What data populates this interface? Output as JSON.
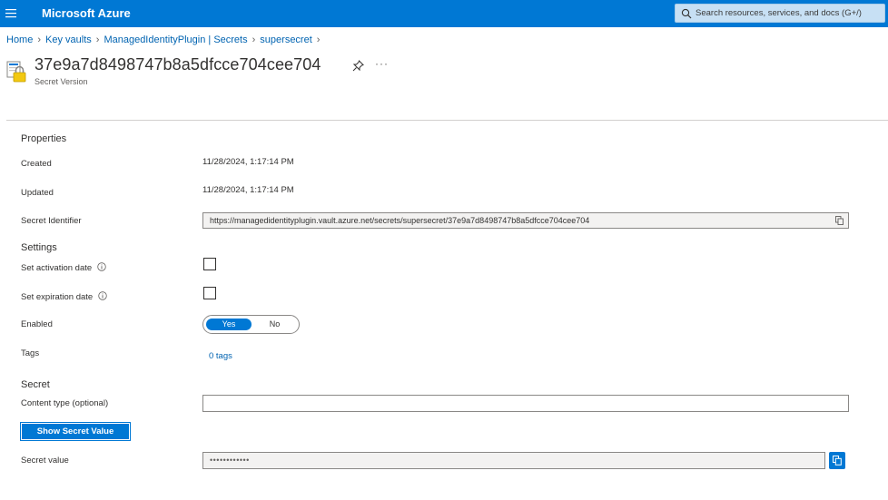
{
  "topbar": {
    "brand": "Microsoft Azure",
    "search_placeholder": "Search resources, services, and docs (G+/)"
  },
  "breadcrumb": {
    "items": [
      "Home",
      "Key vaults",
      "ManagedIdentityPlugin | Secrets",
      "supersecret"
    ]
  },
  "header": {
    "title": "37e9a7d8498747b8a5dfcce704cee704",
    "subtitle": "Secret Version",
    "more": "···"
  },
  "properties": {
    "heading": "Properties",
    "created_label": "Created",
    "created_value": "11/28/2024, 1:17:14 PM",
    "updated_label": "Updated",
    "updated_value": "11/28/2024, 1:17:14 PM",
    "identifier_label": "Secret Identifier",
    "identifier_value": "https://managedidentityplugin.vault.azure.net/secrets/supersecret/37e9a7d8498747b8a5dfcce704cee704"
  },
  "settings": {
    "heading": "Settings",
    "activation_label": "Set activation date",
    "expiration_label": "Set expiration date",
    "enabled_label": "Enabled",
    "enabled_yes": "Yes",
    "enabled_no": "No",
    "tags_label": "Tags",
    "tags_value": "0 tags"
  },
  "secret": {
    "heading": "Secret",
    "content_type_label": "Content type (optional)",
    "content_type_value": "",
    "show_button": "Show Secret Value",
    "value_label": "Secret value",
    "value_masked": "••••••••••••"
  },
  "colors": {
    "accent": "#0078d4",
    "link": "#0063b1"
  }
}
